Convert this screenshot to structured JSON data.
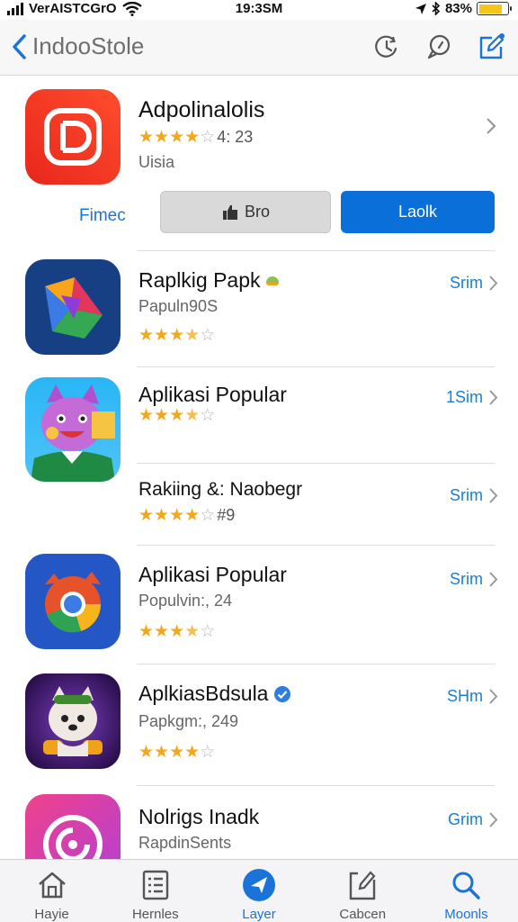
{
  "status_bar": {
    "carrier": "VerAISTCGrO",
    "time": "19:3SM",
    "battery": "83%",
    "battery_level": 0.83
  },
  "nav": {
    "back_label": "IndooStole"
  },
  "featured": {
    "name": "Adpolinalolis",
    "rating_text": "4: 23",
    "stars": 4,
    "subtitle": "Uisia",
    "link_label": "Fimec",
    "grey_button_label": "Bro",
    "blue_button_label": "Laolk"
  },
  "rows": [
    {
      "name": "Raplkig Papk",
      "subtitle": "Papuln90S",
      "stars": 3.5,
      "rating_text": "",
      "action": "Srim"
    },
    {
      "name": "Aplikasi Popular",
      "subtitle": "",
      "stars": 3.5,
      "rating_text": "",
      "action": "1Sim"
    },
    {
      "name": "Rakiing &: Naobegr",
      "subtitle": "",
      "stars": 4,
      "rating_text": "#9",
      "action": "Srim"
    },
    {
      "name": "Aplikasi Popular",
      "subtitle": "Populvin:, 24",
      "stars": 3.5,
      "rating_text": "",
      "action": "Srim"
    },
    {
      "name": "AplkiasBdsula",
      "subtitle": "Papkgm:, 249",
      "stars": 4,
      "rating_text": "",
      "action": "SHm"
    },
    {
      "name": "Nolrigs Inadk",
      "subtitle": "RapdinSents",
      "stars": 0,
      "rating_text": "",
      "action": "Grim"
    }
  ],
  "tabs": [
    {
      "label": "Hayie",
      "icon": "home-icon",
      "active": false
    },
    {
      "label": "Hernles",
      "icon": "list-icon",
      "active": false
    },
    {
      "label": "Layer",
      "icon": "navigate-icon",
      "active": true
    },
    {
      "label": "Cabcen",
      "icon": "edit-icon",
      "active": false
    },
    {
      "label": "Moonls",
      "icon": "search-icon",
      "active": true
    }
  ],
  "colors": {
    "accent": "#1a73d9",
    "star": "#f2a81d",
    "button_blue": "#0a6fd8"
  }
}
